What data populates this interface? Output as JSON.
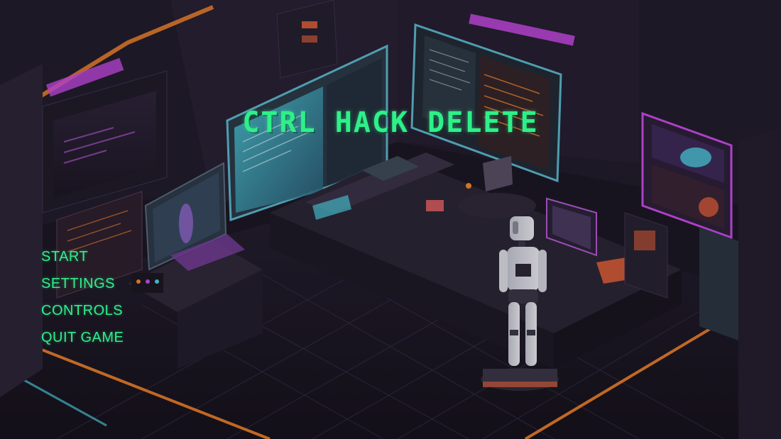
{
  "game": {
    "title": "CTRL HACK DELETE"
  },
  "menu": {
    "items": [
      {
        "label": "START"
      },
      {
        "label": "SETTINGS"
      },
      {
        "label": "CONTROLS"
      },
      {
        "label": "QUIT GAME"
      }
    ]
  },
  "colors": {
    "accent": "#2ef08a",
    "neon_orange": "#ff8a2a",
    "neon_pink": "#d14cf0",
    "neon_cyan": "#4fd8e8",
    "background": "#17141f"
  }
}
